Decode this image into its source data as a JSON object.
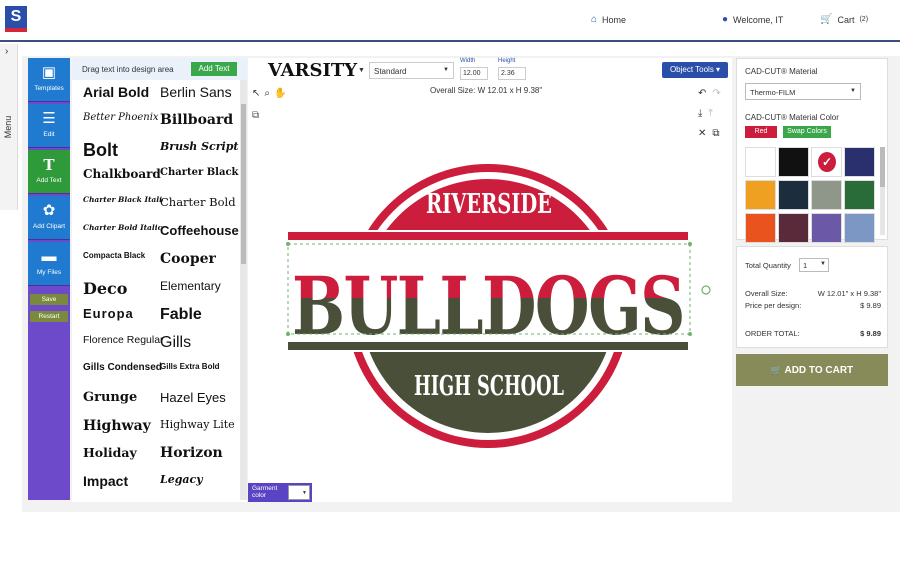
{
  "header": {
    "home_label": "Home",
    "welcome_label": "Welcome, IT",
    "cart_label": "Cart",
    "cart_count": "(2)"
  },
  "menu": {
    "label": "Menu",
    "toggle_icon": "›"
  },
  "tools": [
    {
      "label": "Templates",
      "icon": "templates-icon"
    },
    {
      "label": "Edit",
      "icon": "edit-icon"
    },
    {
      "label": "Add Text",
      "icon": "text-icon"
    },
    {
      "label": "Add Clipart",
      "icon": "clipart-icon"
    },
    {
      "label": "My Files",
      "icon": "folder-icon"
    }
  ],
  "tool_buttons": {
    "save": "Save",
    "restart": "Restart"
  },
  "font_panel": {
    "hint": "Drag text into design area",
    "add_text": "Add Text",
    "fonts": [
      "Arial Bold",
      "Berlin Sans",
      "Better Phoenix",
      "Billboard",
      "Bolt",
      "Brush Script",
      "Chalkboard",
      "Charter Black",
      "Charter Black Italic",
      "Charter Bold",
      "Charter Bold Italic",
      "Coffeehouse",
      "Compacta Black",
      "Cooper",
      "Deco",
      "Elementary",
      "Europa",
      "Fable",
      "Florence Regular",
      "Gills",
      "Gills Condensed",
      "Gills Extra Bold",
      "Grunge",
      "Hazel Eyes",
      "Highway",
      "Highway Lite",
      "Holiday",
      "Horizon",
      "Impact",
      "Legacy"
    ]
  },
  "toolbar": {
    "font_name": "VARSITY",
    "style": "Standard",
    "width_label": "Width",
    "width_value": "12.00",
    "height_label": "Height",
    "height_value": "2.36",
    "object_tools": "Object Tools"
  },
  "canvas": {
    "overall_size": "Overall Size: W 12.01 x H 9.38\"",
    "garment_label": "Garment color",
    "design": {
      "top_text": "RIVERSIDE",
      "main_text": "BULLDOGS",
      "bottom_text": "HIGH SCHOOL",
      "colors": {
        "red": "#cc1d3c",
        "olive": "#4a4f3a",
        "white": "#ffffff"
      }
    }
  },
  "material": {
    "label": "CAD-CUT® Material",
    "value": "Thermo-FILM",
    "color_label": "CAD-CUT® Material Color",
    "selected_color": "Red",
    "swap_label": "Swap Colors",
    "swatches": [
      "#ffffff",
      "#111111",
      "#cc1d3c",
      "#2a2f6e",
      "#f0a020",
      "#1c2e3e",
      "#8f978a",
      "#2a6b3a",
      "#e9531d",
      "#5a2a3a",
      "#6b59a8",
      "#7d97c4"
    ]
  },
  "summary": {
    "qty_label": "Total Quantity",
    "qty_value": "1",
    "overall_label": "Overall Size:",
    "overall_value": "W 12.01\" x H 9.38\"",
    "price_label": "Price per design:",
    "price_value": "$ 9.89",
    "total_label": "ORDER TOTAL:",
    "total_value": "$ 9.89"
  },
  "add_to_cart": "ADD TO CART"
}
